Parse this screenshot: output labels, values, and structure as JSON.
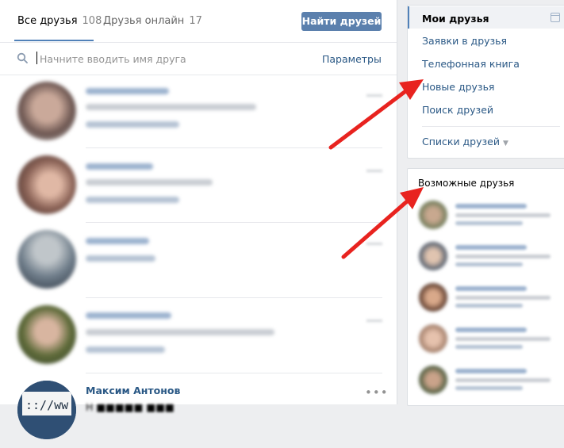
{
  "tabs": {
    "all_label": "Все друзья",
    "all_count": "108",
    "online_label": "Друзья онлайн",
    "online_count": "17"
  },
  "find_button": "Найти друзей",
  "search": {
    "placeholder": "Начните вводить имя друга",
    "params_label": "Параметры"
  },
  "friends_visible": [
    {
      "name": "Максим Антонов",
      "more_icon": "more-dots-icon"
    }
  ],
  "right_menu": {
    "items": [
      {
        "label": "Мои друзья",
        "active": true
      },
      {
        "label": "Заявки в друзья"
      },
      {
        "label": "Телефонная книга"
      },
      {
        "label": "Новые друзья"
      },
      {
        "label": "Поиск друзей"
      }
    ],
    "lists_label": "Списки друзей"
  },
  "possible_friends": {
    "title": "Возможные друзья"
  },
  "colors": {
    "accent": "#5181b8",
    "button": "#5b80ad",
    "link": "#2a5885",
    "arrow": "#e8231f"
  }
}
